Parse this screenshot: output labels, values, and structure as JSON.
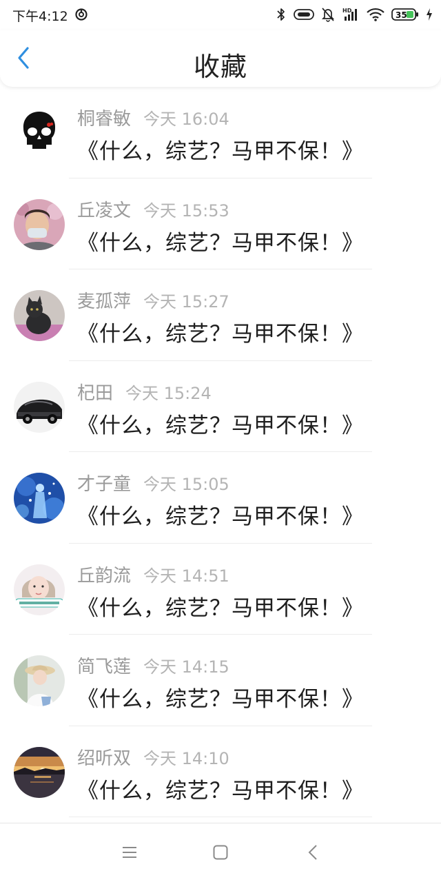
{
  "status_bar": {
    "time": "下午4:12",
    "battery": "35",
    "network_badge": "HD",
    "icons": [
      "sync-icon",
      "bluetooth-icon",
      "vibrate-icon",
      "mute-bell-icon",
      "signal-icon",
      "wifi-icon",
      "battery-icon",
      "charging-icon"
    ]
  },
  "header": {
    "back_icon": "chevron-left-icon",
    "title": "收藏"
  },
  "accent_color": "#2f8fe0",
  "items": [
    {
      "name": "桐睿敏",
      "time": "今天 16:04",
      "title": "《什么，综艺？马甲不保！》",
      "avatar": "skull"
    },
    {
      "name": "丘凌文",
      "time": "今天 15:53",
      "title": "《什么，综艺？马甲不保！》",
      "avatar": "masked-person"
    },
    {
      "name": "麦孤萍",
      "time": "今天 15:27",
      "title": "《什么，综艺？马甲不保！》",
      "avatar": "cat"
    },
    {
      "name": "杞田",
      "time": "今天 15:24",
      "title": "《什么，综艺？马甲不保！》",
      "avatar": "car"
    },
    {
      "name": "才子童",
      "time": "今天 15:05",
      "title": "《什么，综艺？马甲不保！》",
      "avatar": "blue-figure"
    },
    {
      "name": "丘韵流",
      "time": "今天 14:51",
      "title": "《什么，综艺？马甲不保！》",
      "avatar": "girl-caption"
    },
    {
      "name": "简飞莲",
      "time": "今天 14:15",
      "title": "《什么，综艺？马甲不保！》",
      "avatar": "girl-hat"
    },
    {
      "name": "绍听双",
      "time": "今天 14:10",
      "title": "《什么，综艺？马甲不保！》",
      "avatar": "sunset"
    }
  ],
  "nav_bar": {
    "icons": [
      "menu-icon",
      "home-square-icon",
      "back-triangle-icon"
    ]
  }
}
